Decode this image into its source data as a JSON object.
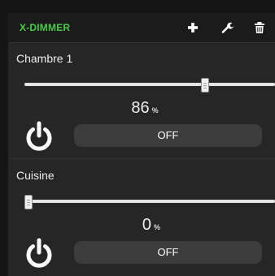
{
  "widget": {
    "title": "X-DIMMER",
    "title_color": "#4cc94a",
    "header_icons": [
      "plus-icon",
      "wrench-icon",
      "trash-icon"
    ]
  },
  "devices": [
    {
      "name": "Chambre 1",
      "value": "86",
      "unit": "%",
      "level_percent": 86,
      "button_label": "OFF",
      "power_icon": "power-icon"
    },
    {
      "name": "Cuisine",
      "value": "0",
      "unit": "%",
      "level_percent": 0,
      "button_label": "OFF",
      "power_icon": "power-icon"
    }
  ]
}
